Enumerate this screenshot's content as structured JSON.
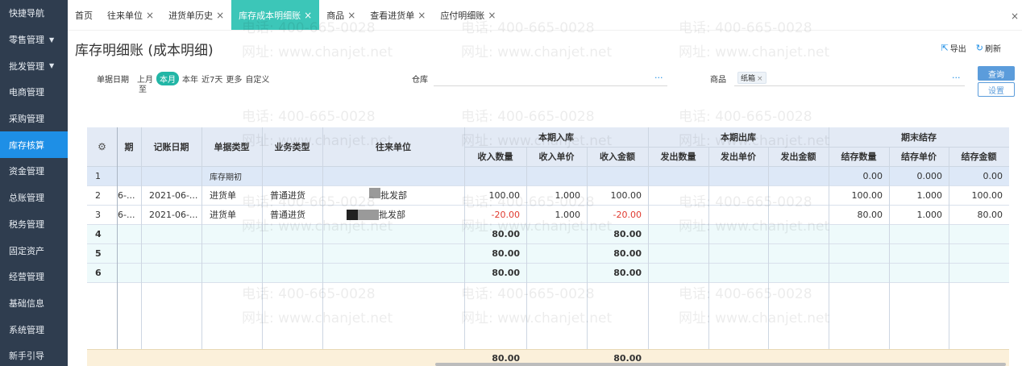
{
  "sidebar": {
    "items": [
      {
        "label": "快捷导航",
        "caret": ""
      },
      {
        "label": "零售管理",
        "caret": "▼"
      },
      {
        "label": "批发管理",
        "caret": "▼"
      },
      {
        "label": "电商管理",
        "caret": ""
      },
      {
        "label": "采购管理",
        "caret": ""
      },
      {
        "label": "库存核算",
        "caret": ""
      },
      {
        "label": "资金管理",
        "caret": ""
      },
      {
        "label": "总账管理",
        "caret": ""
      },
      {
        "label": "税务管理",
        "caret": ""
      },
      {
        "label": "固定资产",
        "caret": ""
      },
      {
        "label": "经营管理",
        "caret": ""
      },
      {
        "label": "基础信息",
        "caret": ""
      },
      {
        "label": "系统管理",
        "caret": ""
      },
      {
        "label": "新手引导",
        "caret": ""
      }
    ],
    "active_index": 5
  },
  "tabs": [
    {
      "label": "首页",
      "close": ""
    },
    {
      "label": "往来单位",
      "close": "×"
    },
    {
      "label": "进货单历史",
      "close": "×"
    },
    {
      "label": "库存成本明细账",
      "close": "×"
    },
    {
      "label": "商品",
      "close": "×"
    },
    {
      "label": "查看进货单",
      "close": "×"
    },
    {
      "label": "应付明细账",
      "close": "×"
    }
  ],
  "tabbar_close": "×",
  "page": {
    "title": "库存明细账 (成本明细)",
    "export_label": "导出",
    "refresh_label": "刷新"
  },
  "filters": {
    "date_label": "单据日期",
    "date_options": [
      "上月",
      "本月",
      "本年",
      "近7天",
      "更多",
      "自定义"
    ],
    "date_active": "本月",
    "date_to": "至",
    "warehouse_label": "仓库",
    "warehouse_more": "···",
    "product_label": "商品",
    "product_tag": "纸箱",
    "product_tag_x": "×",
    "product_more": "···",
    "query_button": "查询",
    "settings_button": "设置"
  },
  "table": {
    "headers": {
      "period": "期",
      "date": "记账日期",
      "doc_type": "单据类型",
      "biz_type": "业务类型",
      "partner": "往来单位",
      "group_in": "本期入库",
      "group_out": "本期出库",
      "group_end": "期末结存",
      "in_qty": "收入数量",
      "in_price": "收入单价",
      "in_amt": "收入金额",
      "out_qty": "发出数量",
      "out_price": "发出单价",
      "out_amt": "发出金额",
      "end_qty": "结存数量",
      "end_price": "结存单价",
      "end_amt": "结存金额"
    },
    "rows": [
      {
        "no": "1",
        "period": "",
        "date": "",
        "doc_type": "库存期初",
        "biz_type": "",
        "partner": "",
        "in_qty": "",
        "in_price": "",
        "in_amt": "",
        "end_qty": "0.00",
        "end_price": "0.000",
        "end_amt": "0.00"
      },
      {
        "no": "2",
        "period": "6-...",
        "date": "2021-06-...",
        "doc_type": "进货单",
        "biz_type": "普通进货",
        "partner": "批发部",
        "in_qty": "100.00",
        "in_price": "1.000",
        "in_amt": "100.00",
        "end_qty": "100.00",
        "end_price": "1.000",
        "end_amt": "100.00"
      },
      {
        "no": "3",
        "period": "6-...",
        "date": "2021-06-...",
        "doc_type": "进货单",
        "biz_type": "普通进货",
        "partner": "批发部",
        "in_qty": "-20.00",
        "in_price": "1.000",
        "in_amt": "-20.00",
        "end_qty": "80.00",
        "end_price": "1.000",
        "end_amt": "80.00"
      },
      {
        "no": "4",
        "in_qty": "80.00",
        "in_amt": "80.00"
      },
      {
        "no": "5",
        "in_qty": "80.00",
        "in_amt": "80.00"
      },
      {
        "no": "6",
        "in_qty": "80.00",
        "in_amt": "80.00"
      }
    ],
    "footer": {
      "in_qty": "80.00",
      "in_amt": "80.00"
    }
  },
  "watermark": {
    "phone": "电话: 400-665-0028",
    "site": "网址: www.chanjet.net"
  },
  "colors": {
    "sidebar_bg": "#2f3d4f",
    "active_accent": "#1e8fe6",
    "active_tab": "#3cc6b8",
    "header_bg": "#e3eaf5",
    "negative": "#e03a2f"
  }
}
